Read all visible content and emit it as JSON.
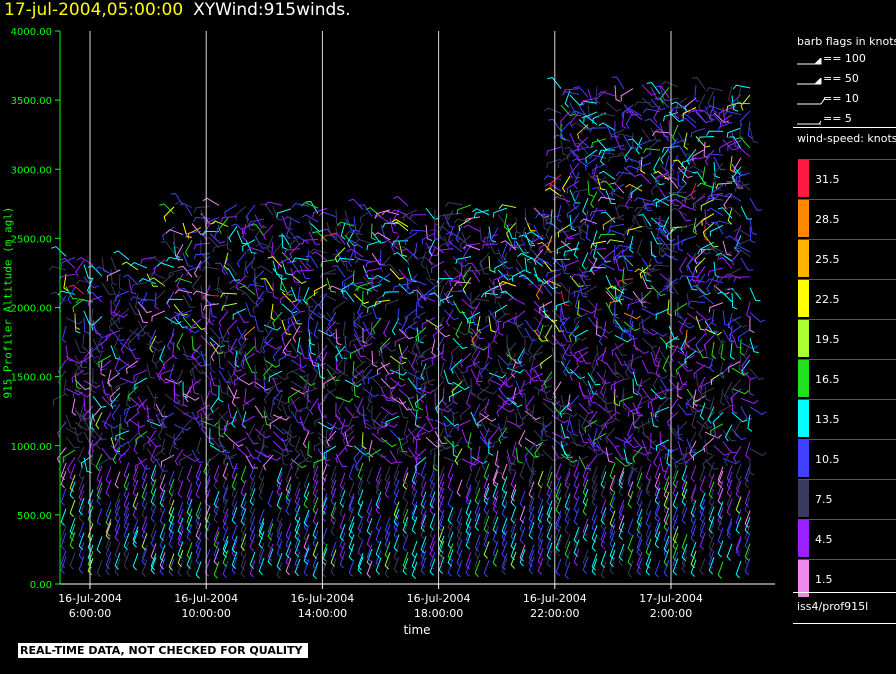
{
  "title": {
    "date": "17-jul-2004,05:00:00",
    "name": "XYWind:915winds."
  },
  "footer_text": "REAL-TIME DATA, NOT CHECKED FOR QUALITY",
  "source": "iss4/prof915l",
  "colors": {
    "axis": "#00ff00",
    "background": "#000000",
    "title_date": "#ffff00"
  },
  "chart_data": {
    "type": "scatter",
    "subtype": "wind-barb time-height plot",
    "ylabel": "915 Profiler Altitude (m agl)",
    "xlabel": "time",
    "ylim": [
      0,
      4000
    ],
    "yticks": [
      "0.00",
      "500.00",
      "1000.00",
      "1500.00",
      "2000.00",
      "2500.00",
      "3000.00",
      "3500.00",
      "4000.00"
    ],
    "xticks": [
      {
        "date": "16-Jul-2004",
        "time": "6:00:00"
      },
      {
        "date": "16-Jul-2004",
        "time": "10:00:00"
      },
      {
        "date": "16-Jul-2004",
        "time": "14:00:00"
      },
      {
        "date": "16-Jul-2004",
        "time": "18:00:00"
      },
      {
        "date": "16-Jul-2004",
        "time": "22:00:00"
      },
      {
        "date": "17-Jul-2004",
        "time": "2:00:00"
      }
    ],
    "grid": "vertical lines at x ticks",
    "barb_legend": {
      "title": "barb flags in knots",
      "entries": [
        "== 100",
        "== 50",
        "== 10",
        "== 5"
      ]
    },
    "speed_legend": {
      "title": "wind-speed: knots",
      "bins": [
        {
          "label": "31.5",
          "color": "#ff1a40"
        },
        {
          "label": "28.5",
          "color": "#ff8800"
        },
        {
          "label": "25.5",
          "color": "#ffb400"
        },
        {
          "label": "22.5",
          "color": "#ffff00"
        },
        {
          "label": "19.5",
          "color": "#aaff30"
        },
        {
          "label": "16.5",
          "color": "#20e020"
        },
        {
          "label": "13.5",
          "color": "#00ffff"
        },
        {
          "label": "10.5",
          "color": "#4040ff"
        },
        {
          "label": "7.5",
          "color": "#3a3a60"
        },
        {
          "label": "4.5",
          "color": "#9a20ff"
        },
        {
          "label": "1.5",
          "color": "#ee88ee"
        }
      ]
    }
  }
}
